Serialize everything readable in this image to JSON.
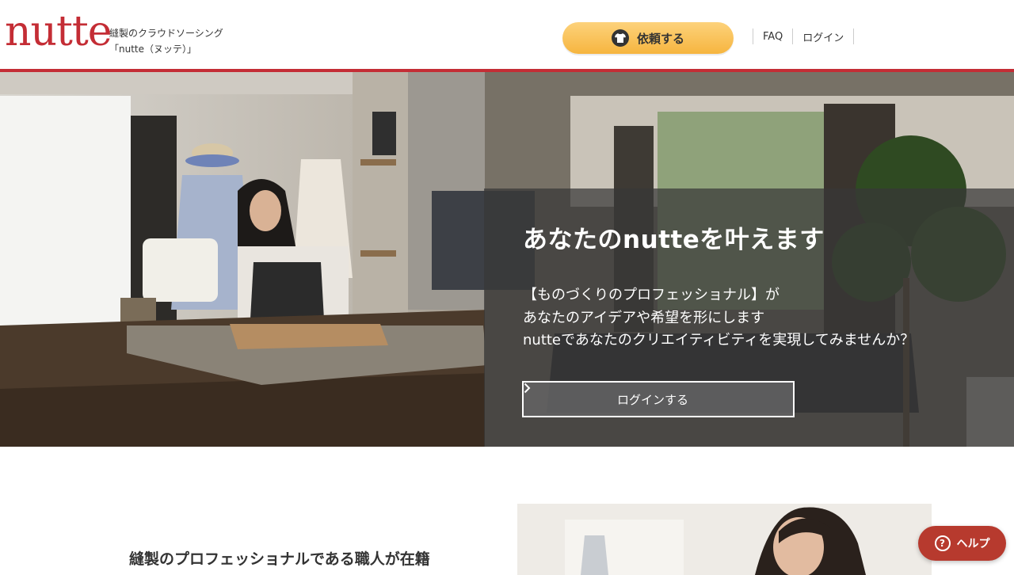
{
  "header": {
    "logo_text": "nutte",
    "tagline_line1": "縫製のクラウドソーシング",
    "tagline_line2": "「nutte（ヌッテ）」",
    "request_button_label": "依頼する",
    "nav": [
      {
        "label": "FAQ"
      },
      {
        "label": "ログイン"
      }
    ]
  },
  "hero": {
    "title": "あなたのnutteを叶えます",
    "lines": [
      "【ものづくりのプロフェッショナル】が",
      "あなたのアイデアや希望を形にします",
      "nutteであなたのクリエイティビティを実現してみませんか？"
    ],
    "login_button_label": "ログインする",
    "login_button_icon": "chevron-right-icon",
    "image": "seamstress-at-sewing-machine-photo"
  },
  "section": {
    "heading": "縫製のプロフェッショナルである職人が在籍",
    "image": "smiling-craftswoman-photo"
  },
  "help": {
    "label": "ヘルプ",
    "icon": "question-circle-icon"
  },
  "colors": {
    "brand_red": "#c42d35",
    "request_button": "#f6b53f",
    "help_button": "#b73a2e",
    "overlay": "#373737"
  }
}
